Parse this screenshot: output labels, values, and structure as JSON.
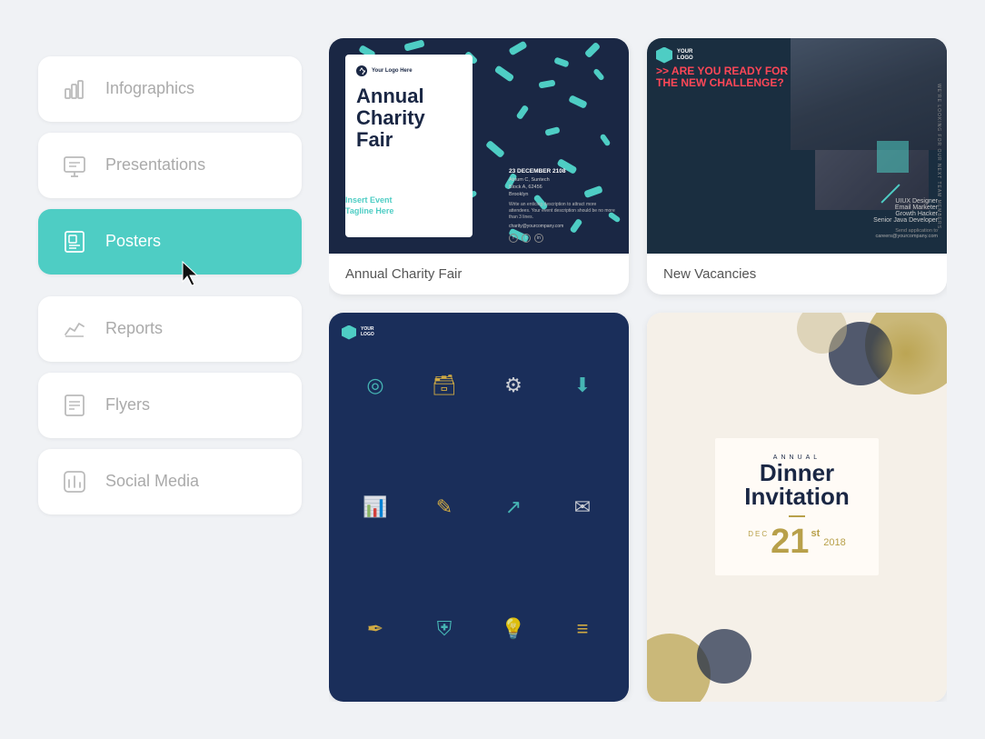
{
  "sidebar": {
    "items": [
      {
        "id": "infographics",
        "label": "Infographics",
        "icon": "bar-chart-icon",
        "active": false
      },
      {
        "id": "presentations",
        "label": "Presentations",
        "icon": "presentation-icon",
        "active": false
      },
      {
        "id": "posters",
        "label": "Posters",
        "icon": "poster-icon",
        "active": true
      },
      {
        "id": "reports",
        "label": "Reports",
        "icon": "reports-icon",
        "active": false
      },
      {
        "id": "flyers",
        "label": "Flyers",
        "icon": "flyers-icon",
        "active": false
      },
      {
        "id": "social-media",
        "label": "Social Media",
        "icon": "social-icon",
        "active": false
      }
    ]
  },
  "grid": {
    "cards": [
      {
        "id": "annual-charity-fair",
        "label": "Annual Charity Fair"
      },
      {
        "id": "new-vacancies",
        "label": "New Vacancies"
      },
      {
        "id": "tech-poster",
        "label": ""
      },
      {
        "id": "dinner-invitation",
        "label": ""
      }
    ]
  },
  "charity_poster": {
    "logo_text": "Your Logo Here",
    "title": "Annual Charity Fair",
    "tagline": "Insert Event\nTagline Here",
    "date": "23 DECEMBER 2108",
    "venue": "Atrium C, Suntech\nBlock A, 62456\nBrooklyn",
    "description": "Write an enticing description to attract more attendees.",
    "email": "charity@yourcompany.com"
  },
  "vacancies_poster": {
    "logo_text": "YOUR LOGO",
    "headline": ">> ARE YOU READY FOR THE NEW CHALLENGE?",
    "sidebar_text": "WE'RE LOOKING FOR OUR NEXT TEAM MEMBERS.",
    "roles": [
      "UIUX Designer",
      "Email Marketer",
      "Growth Hacker",
      "Senior Java Developer"
    ],
    "apply_text": "Send application to",
    "email": "careers@yourcompany.com"
  },
  "dinner_poster": {
    "annual_text": "ANNUAL",
    "title_line1": "Dinner",
    "title_line2": "Invitation",
    "dec_label": "DEC",
    "day": "21",
    "suffix": "st",
    "year": "2018"
  }
}
